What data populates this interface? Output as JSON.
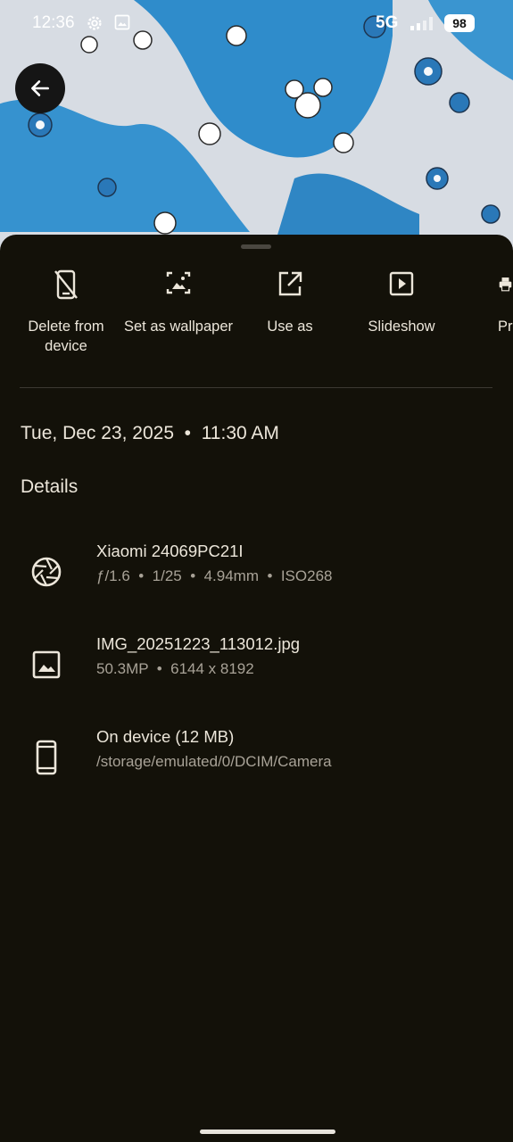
{
  "status_bar": {
    "time": "12:36",
    "network": "5G",
    "battery": "98",
    "icons": [
      "settings-icon",
      "gallery-icon",
      "signal-icon"
    ]
  },
  "header": {
    "back_icon": "arrow-left-icon"
  },
  "actions": [
    {
      "label": "Delete from device",
      "icon": "delete-device-icon"
    },
    {
      "label": "Set as wallpaper",
      "icon": "wallpaper-icon"
    },
    {
      "label": "Use as",
      "icon": "open-external-icon"
    },
    {
      "label": "Slideshow",
      "icon": "slideshow-icon"
    },
    {
      "label": "Pr",
      "icon": "print-icon"
    }
  ],
  "date_time": "Tue, Dec 23, 2025  •  11:30 AM",
  "details": {
    "title": "Details",
    "rows": [
      {
        "title": "Xiaomi 24069PC21I",
        "subtitle": "ƒ/1.6  •  1/25  •  4.94mm  •  ISO268",
        "icon": "aperture-icon"
      },
      {
        "title": "IMG_20251223_113012.jpg",
        "subtitle": "50.3MP  •  6144 x 8192",
        "icon": "image-icon"
      },
      {
        "title": "On device (12 MB)",
        "subtitle": "/storage/emulated/0/DCIM/Camera",
        "icon": "phone-icon"
      }
    ]
  },
  "colors": {
    "sheet_bg": "#131109",
    "text_primary": "#ece6da",
    "text_secondary": "#a8a297",
    "fabric_blue": "#2f8ccb"
  }
}
